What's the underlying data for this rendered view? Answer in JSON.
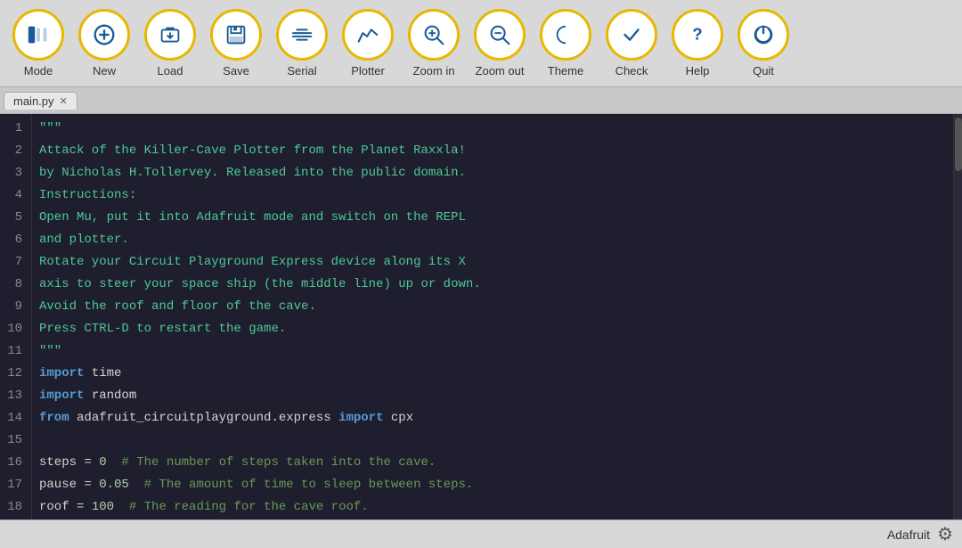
{
  "toolbar": {
    "buttons": [
      {
        "id": "mode",
        "label": "Mode",
        "icon": "mode"
      },
      {
        "id": "new",
        "label": "New",
        "icon": "new"
      },
      {
        "id": "load",
        "label": "Load",
        "icon": "load"
      },
      {
        "id": "save",
        "label": "Save",
        "icon": "save"
      },
      {
        "id": "serial",
        "label": "Serial",
        "icon": "serial"
      },
      {
        "id": "plotter",
        "label": "Plotter",
        "icon": "plotter"
      },
      {
        "id": "zoom_in",
        "label": "Zoom in",
        "icon": "zoom_in"
      },
      {
        "id": "zoom_out",
        "label": "Zoom out",
        "icon": "zoom_out"
      },
      {
        "id": "theme",
        "label": "Theme",
        "icon": "theme"
      },
      {
        "id": "check",
        "label": "Check",
        "icon": "check"
      },
      {
        "id": "help",
        "label": "Help",
        "icon": "help"
      },
      {
        "id": "quit",
        "label": "Quit",
        "icon": "quit"
      }
    ]
  },
  "tabs": [
    {
      "label": "main.py",
      "active": true
    }
  ],
  "editor": {
    "lines": [
      {
        "num": 1,
        "tokens": [
          {
            "t": "\"\"\"",
            "c": "str"
          }
        ]
      },
      {
        "num": 2,
        "tokens": [
          {
            "t": "Attack of the Killer-Cave Plotter from the Planet Raxxla!",
            "c": "green"
          }
        ]
      },
      {
        "num": 3,
        "tokens": [
          {
            "t": "by Nicholas H.Tollervey. Released into the public domain.",
            "c": "green"
          }
        ]
      },
      {
        "num": 4,
        "tokens": [
          {
            "t": "Instructions:",
            "c": "green"
          }
        ]
      },
      {
        "num": 5,
        "tokens": [
          {
            "t": "Open Mu, put it into Adafruit mode and switch on the REPL",
            "c": "green"
          }
        ]
      },
      {
        "num": 6,
        "tokens": [
          {
            "t": "and plotter.",
            "c": "green"
          }
        ]
      },
      {
        "num": 7,
        "tokens": [
          {
            "t": "Rotate your Circuit Playground Express device along its X",
            "c": "green"
          }
        ]
      },
      {
        "num": 8,
        "tokens": [
          {
            "t": "axis to steer your space ship (the middle line) up or down.",
            "c": "green"
          }
        ]
      },
      {
        "num": 9,
        "tokens": [
          {
            "t": "Avoid the roof and floor of the cave.",
            "c": "green"
          }
        ]
      },
      {
        "num": 10,
        "tokens": [
          {
            "t": "Press CTRL-D to restart the game.",
            "c": "green"
          }
        ]
      },
      {
        "num": 11,
        "tokens": [
          {
            "t": "\"\"\"",
            "c": "str"
          }
        ]
      },
      {
        "num": 12,
        "tokens": [
          {
            "t": "import",
            "c": "kw"
          },
          {
            "t": " time",
            "c": "plain"
          }
        ]
      },
      {
        "num": 13,
        "tokens": [
          {
            "t": "import",
            "c": "kw"
          },
          {
            "t": " random",
            "c": "plain"
          }
        ]
      },
      {
        "num": 14,
        "tokens": [
          {
            "t": "from",
            "c": "kw"
          },
          {
            "t": " adafruit_circuitplayground.express ",
            "c": "plain"
          },
          {
            "t": "import",
            "c": "kw"
          },
          {
            "t": " cpx",
            "c": "plain"
          }
        ]
      },
      {
        "num": 15,
        "tokens": [
          {
            "t": "",
            "c": "plain"
          }
        ]
      },
      {
        "num": 16,
        "tokens": [
          {
            "t": "steps = ",
            "c": "plain"
          },
          {
            "t": "0",
            "c": "num"
          },
          {
            "t": "  # The number of steps taken into the cave.",
            "c": "comment"
          }
        ]
      },
      {
        "num": 17,
        "tokens": [
          {
            "t": "pause = ",
            "c": "plain"
          },
          {
            "t": "0.05",
            "c": "num"
          },
          {
            "t": "  # The amount of time to sleep between steps.",
            "c": "comment"
          }
        ]
      },
      {
        "num": 18,
        "tokens": [
          {
            "t": "roof = ",
            "c": "plain"
          },
          {
            "t": "100",
            "c": "num"
          },
          {
            "t": "  # The reading for the cave roof.",
            "c": "comment"
          }
        ]
      }
    ]
  },
  "status": {
    "mode": "Adafruit",
    "gear_icon": "⚙"
  }
}
